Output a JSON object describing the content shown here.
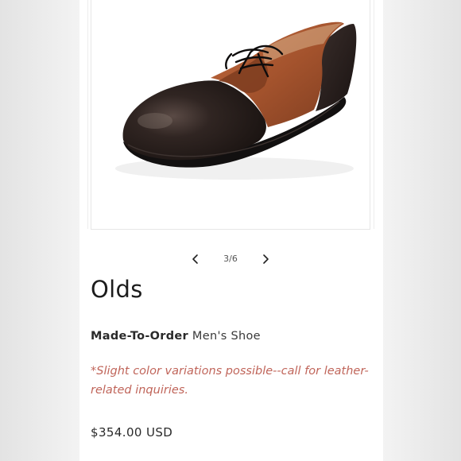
{
  "gallery": {
    "current": 3,
    "total": 6,
    "counter_text": "3/6",
    "image_icon": "shoe-product-photo",
    "prev_icon": "chevron-left-icon",
    "next_icon": "chevron-right-icon"
  },
  "product": {
    "title": "Olds",
    "subtitle_strong": "Made-To-Order",
    "subtitle_rest": " Men's Shoe",
    "note": "*Slight color variations possible--call for leather-related inquiries.",
    "price": "$354.00 USD"
  },
  "colors": {
    "note_text": "#c0655a",
    "leather_dark": "#2b2220",
    "leather_tan": "#a4532d"
  }
}
